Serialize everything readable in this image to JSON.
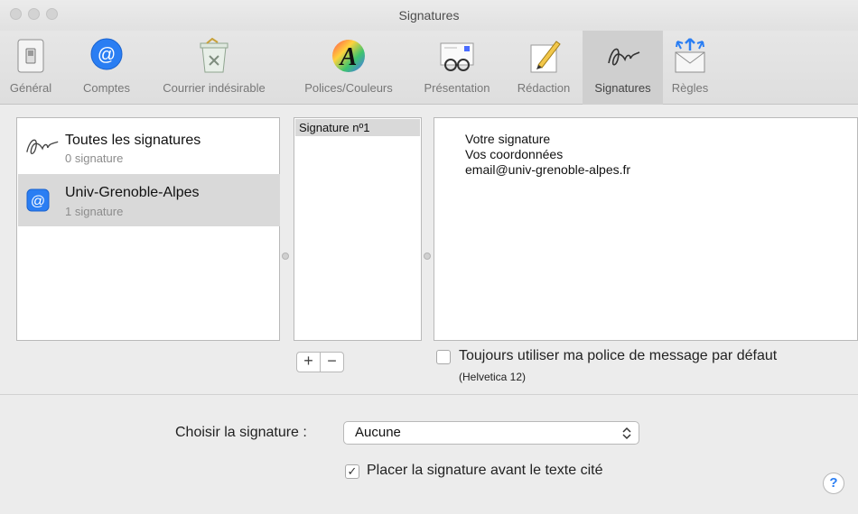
{
  "window": {
    "title": "Signatures"
  },
  "toolbar": {
    "items": [
      {
        "label": "Général",
        "icon": "switch-icon"
      },
      {
        "label": "Comptes",
        "icon": "at-sign-icon"
      },
      {
        "label": "Courrier indésirable",
        "icon": "junk-trash-icon"
      },
      {
        "label": "Polices/Couleurs",
        "icon": "font-colors-icon"
      },
      {
        "label": "Présentation",
        "icon": "glasses-letter-icon"
      },
      {
        "label": "Rédaction",
        "icon": "pencil-paper-icon"
      },
      {
        "label": "Signatures",
        "icon": "signature-icon"
      },
      {
        "label": "Règles",
        "icon": "rules-envelope-icon"
      }
    ],
    "active": "Signatures"
  },
  "accounts": [
    {
      "name": "Toutes les signatures",
      "count": "0 signature",
      "icon": "signature-icon"
    },
    {
      "name": "Univ-Grenoble-Alpes",
      "count": "1 signature",
      "icon": "at-sign-icon",
      "selected": true
    }
  ],
  "signatures": {
    "items": [
      "Signature nº1"
    ]
  },
  "editor": {
    "lines": [
      "Votre signature",
      "Vos coordonnées",
      "email@univ-grenoble-alpes.fr"
    ]
  },
  "list_controls": {
    "add": "+",
    "remove": "−"
  },
  "default_font": {
    "label": "Toujours utiliser ma police de message par défaut",
    "font": "(Helvetica 12)",
    "checked": false
  },
  "choose": {
    "label": "Choisir la signature :",
    "value": "Aucune"
  },
  "place_before": {
    "label": "Placer la signature avant le texte cité",
    "checked": true,
    "mark": "✓"
  },
  "help": {
    "label": "?"
  },
  "colors": {
    "accent": "#2a7ef3",
    "selection": "#d9d9d9"
  }
}
